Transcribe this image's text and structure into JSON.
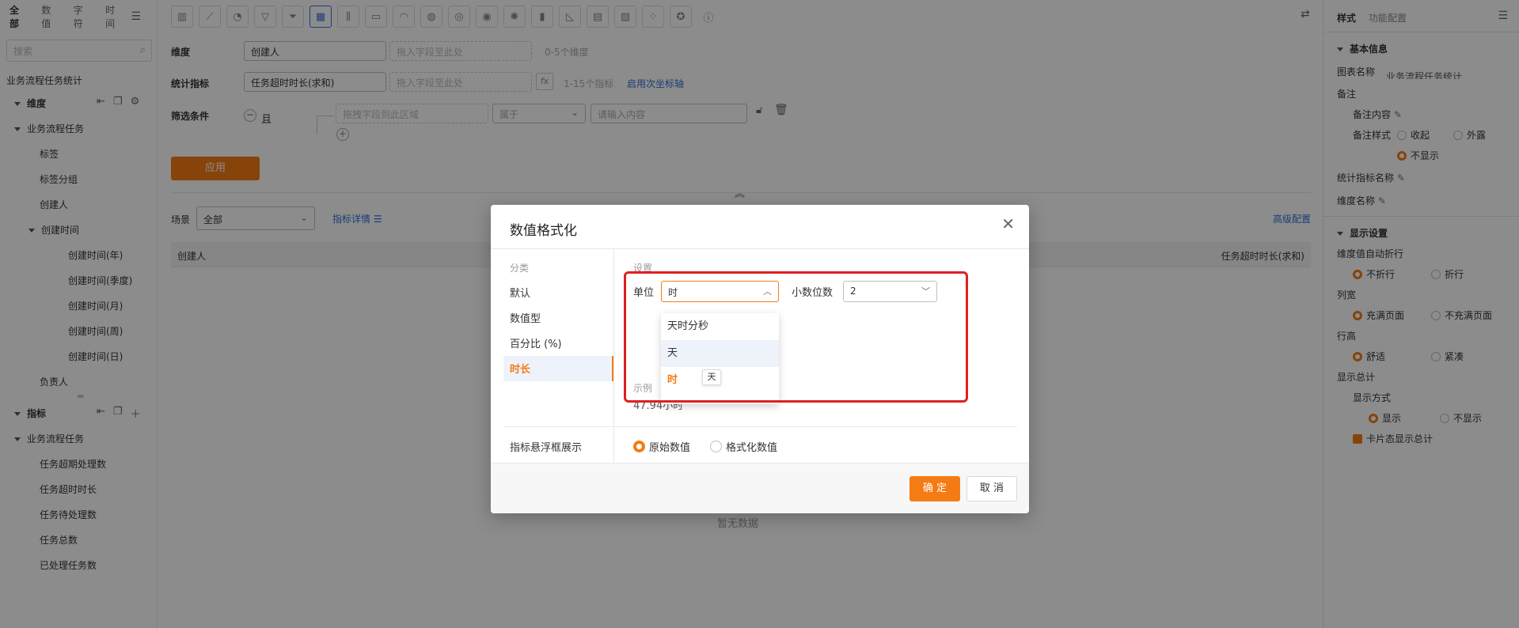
{
  "left": {
    "tabs": [
      "全部",
      "数值",
      "字符",
      "时间"
    ],
    "search_placeholder": "搜索",
    "dataset": "业务流程任务统计",
    "dim_title": "维度",
    "dim_group": "业务流程任务",
    "dim_items": [
      "标签",
      "标签分组",
      "创建人"
    ],
    "time_group": "创建时间",
    "time_items": [
      "创建时间(年)",
      "创建时间(季度)",
      "创建时间(月)",
      "创建时间(周)",
      "创建时间(日)"
    ],
    "owner": "负责人",
    "metric_title": "指标",
    "metric_group": "业务流程任务",
    "metric_items": [
      "任务超期处理数",
      "任务超时时长",
      "任务待处理数",
      "任务总数",
      "已处理任务数"
    ]
  },
  "center": {
    "dimension_label": "维度",
    "dimension_value": "创建人",
    "drag_placeholder": "拖入字段至此处",
    "dimension_hint": "0-5个维度",
    "metric_label": "统计指标",
    "metric_value": "任务超时时长(求和)",
    "fx": "fx",
    "metric_hint": "1-15个指标",
    "secondary_axis": "启用次坐标轴",
    "filter_label": "筛选条件",
    "filter_and": "且",
    "filter_drag": "拖拽字段到此区域",
    "filter_op": "属于",
    "filter_input": "请输入内容",
    "apply": "应用",
    "scene_label": "场景",
    "scene_value": "全部",
    "metric_detail": "指标详情",
    "advanced": "高级配置",
    "col_left": "创建人",
    "col_right": "任务超时时长(求和)",
    "empty": "暂无数据"
  },
  "right": {
    "tab_style": "样式",
    "tab_func": "功能配置",
    "basic_title": "基本信息",
    "chart_name_label": "图表名称",
    "chart_name_value": "业务流程任务统计",
    "remark": "备注",
    "remark_content": "备注内容",
    "remark_style": "备注样式",
    "remark_opts": [
      "收起",
      "外露",
      "不显示"
    ],
    "metric_name": "统计指标名称",
    "dim_name": "维度名称",
    "display_title": "显示设置",
    "wrap_label": "维度值自动折行",
    "wrap_opts": [
      "不折行",
      "折行"
    ],
    "colwidth_label": "列宽",
    "colwidth_opts": [
      "充满页面",
      "不充满页面"
    ],
    "rowheight_label": "行高",
    "rowheight_opts": [
      "舒适",
      "紧凑"
    ],
    "total_label": "显示总计",
    "total_mode_label": "显示方式",
    "total_opts": [
      "显示",
      "不显示"
    ],
    "card_total": "卡片态显示总计"
  },
  "modal": {
    "title": "数值格式化",
    "category_header": "分类",
    "categories": [
      "默认",
      "数值型",
      "百分比 (%)",
      "时长"
    ],
    "settings_header": "设置",
    "unit_label": "单位",
    "unit_value": "时",
    "decimal_label": "小数位数",
    "decimal_value": "2",
    "unit_options": [
      "天时分秒",
      "天",
      "时"
    ],
    "tooltip": "天",
    "example_header": "示例",
    "example_value": "47.94小时",
    "hover_label": "指标悬浮框展示",
    "hover_opts": [
      "原始数值",
      "格式化数值"
    ],
    "ok": "确 定",
    "cancel": "取 消"
  },
  "colors": {
    "accent": "#f57c14",
    "link": "#2f6fd3",
    "highlight": "#e02020"
  }
}
